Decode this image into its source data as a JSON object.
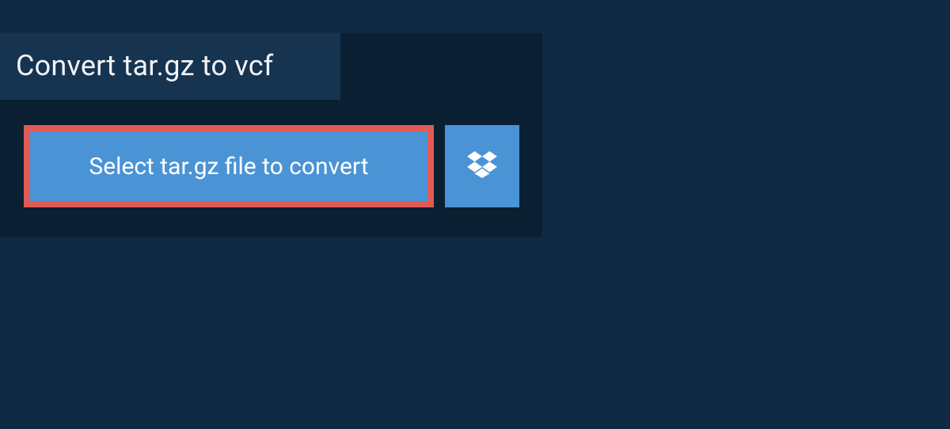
{
  "title": "Convert tar.gz to vcf",
  "selectButton": {
    "label": "Select tar.gz file to convert"
  },
  "colors": {
    "pageBackground": "#102a43",
    "panelBackground": "#0b1f33",
    "tabBackground": "#163350",
    "buttonBackground": "#4a94d6",
    "highlightBorder": "#e05a56",
    "textLight": "#f0f4f8",
    "textWhite": "#ffffff"
  }
}
